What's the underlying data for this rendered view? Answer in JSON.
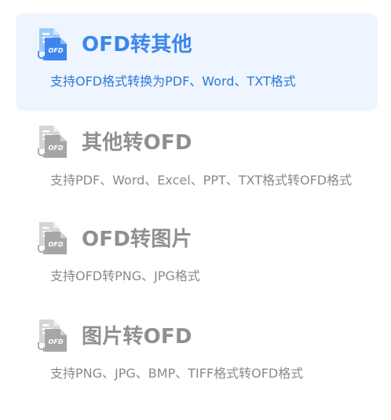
{
  "colors": {
    "active_title": "#3c86ec",
    "active_desc": "#2f77d9",
    "active_bg": "#eef5fe",
    "inactive_text": "#8f8f8f"
  },
  "menu": {
    "items": [
      {
        "title": "OFD转其他",
        "description": "支持OFD格式转换为PDF、Word、TXT格式",
        "icon": "file-convert-icon",
        "icon_label": "OFD",
        "selected": true
      },
      {
        "title": "其他转OFD",
        "description": "支持PDF、Word、Excel、PPT、TXT格式转OFD格式",
        "icon": "file-convert-icon",
        "icon_label": "OFD",
        "selected": false
      },
      {
        "title": "OFD转图片",
        "description": "支持OFD转PNG、JPG格式",
        "icon": "file-convert-icon",
        "icon_label": "OFD",
        "selected": false
      },
      {
        "title": "图片转OFD",
        "description": "支持PNG、JPG、BMP、TIFF格式转OFD格式",
        "icon": "file-convert-icon",
        "icon_label": "OFD",
        "selected": false
      }
    ]
  }
}
